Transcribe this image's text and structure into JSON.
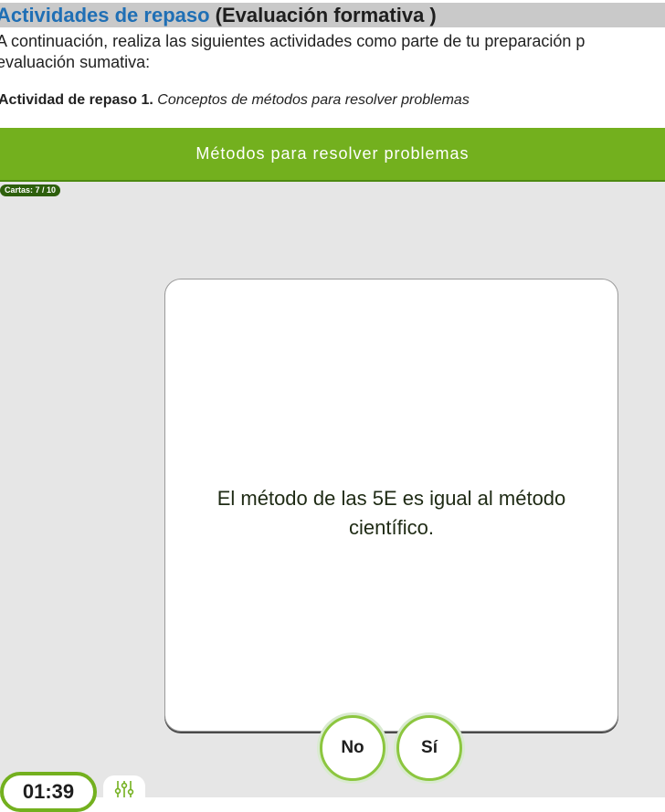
{
  "page": {
    "title_blue": "Actividades de repaso",
    "title_dark": "(Evaluación formativa )",
    "intro_line1": "A continuación, realiza las siguientes actividades como parte de tu preparación p",
    "intro_line2": "evaluación sumativa:",
    "activity_label": "Actividad de repaso 1.",
    "activity_subtitle": "Conceptos de métodos para resolver problemas"
  },
  "game": {
    "title": "Métodos para resolver problemas",
    "card_counter": "Cartas: 7 / 10",
    "card_text": "El método de las 5E es igual al método científico.",
    "no_label": "No",
    "yes_label": "Sí",
    "timer": "01:39",
    "settings_icon": "sliders-icon"
  },
  "colors": {
    "header_green": "#73b01e",
    "title_blue": "#1f6fb5",
    "panel_gray": "#e6e6e6",
    "button_ring": "#8cc63f"
  }
}
